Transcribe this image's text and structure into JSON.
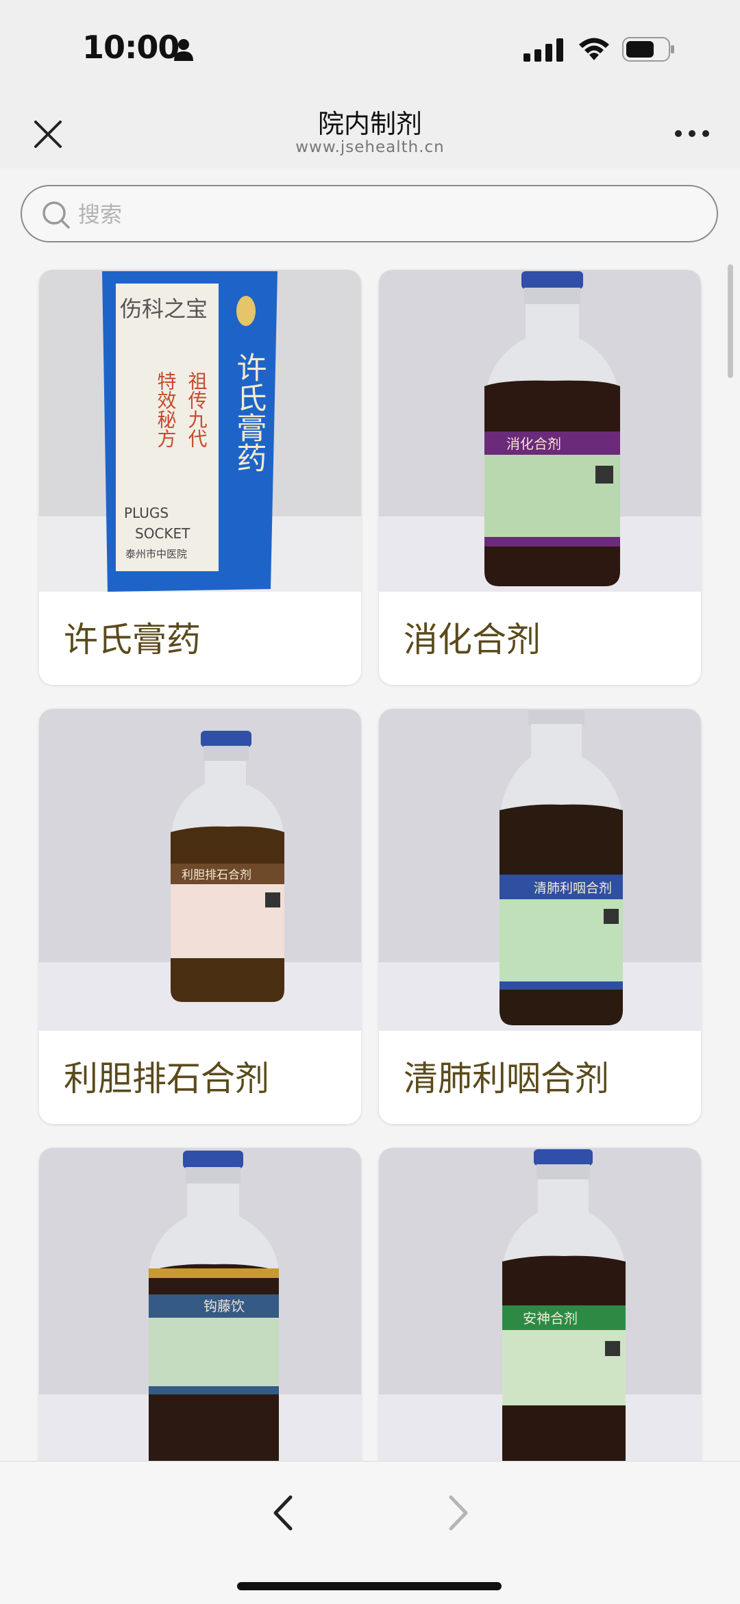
{
  "status_bar": {
    "time": "10:00"
  },
  "nav": {
    "title": "院内制剂",
    "subtitle": "www.jsehealth.cn"
  },
  "search": {
    "placeholder": "搜索",
    "value": ""
  },
  "products": [
    {
      "name": "许氏膏药",
      "image_text": [
        "伤科之宝",
        "祖传九代",
        "特效秘方",
        "许氏膏药",
        "PLUGS",
        "SOCKET",
        "泰州市中医院"
      ]
    },
    {
      "name": "消化合剂",
      "bottle_label": "消化合剂",
      "band_color": "#6b2a7a",
      "label_color": "#b9d8b0"
    },
    {
      "name": "利胆排石合剂",
      "bottle_label": "利胆排石合剂",
      "band_color": "#6e4a2a",
      "label_color": "#f1dfd8"
    },
    {
      "name": "清肺利咽合剂",
      "bottle_label": "清肺利咽合剂",
      "band_color": "#2f4fa0",
      "label_color": "#bfe0b8"
    },
    {
      "name": "钩藤饮",
      "bottle_label": "钩藤饮",
      "band_color": "#355a86",
      "label_color": "#c6dcc0"
    },
    {
      "name": "安神合剂",
      "bottle_label": "安神合剂",
      "band_color": "#2d8a45",
      "label_color": "#cfe4c4"
    }
  ],
  "colors": {
    "label_text": "#5a4a1c",
    "blue_packet": "#1e64c8"
  }
}
